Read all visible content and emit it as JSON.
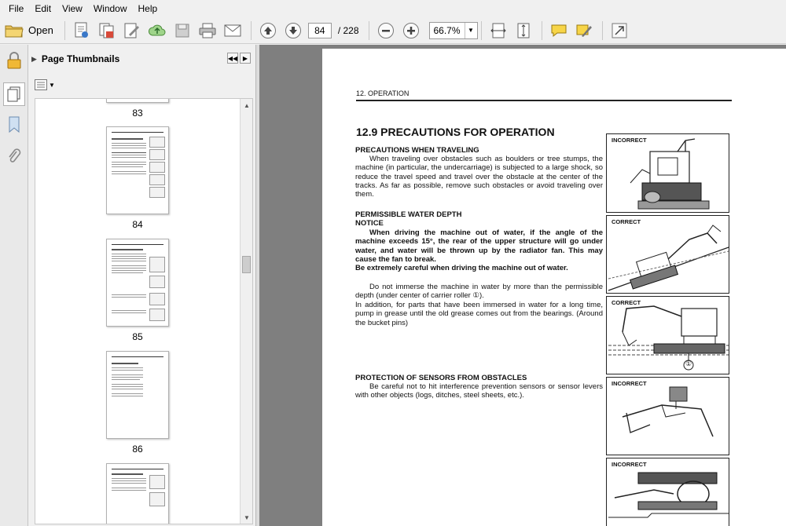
{
  "menu": [
    "File",
    "Edit",
    "View",
    "Window",
    "Help"
  ],
  "toolbar": {
    "open_label": "Open",
    "current_page": "84",
    "page_total": "/ 228",
    "zoom": "66.7%"
  },
  "thumbnail_panel": {
    "title": "Page Thumbnails",
    "thumbnails": [
      {
        "label": "83"
      },
      {
        "label": "84"
      },
      {
        "label": "85"
      },
      {
        "label": "86"
      }
    ]
  },
  "document": {
    "section_header": "12. OPERATION",
    "main_heading": "12.9  PRECAUTIONS FOR OPERATION",
    "traveling_heading": "PRECAUTIONS WHEN TRAVELING",
    "traveling_text": "When traveling over obstacles such as boulders or tree stumps, the machine (in particular, the undercarriage) is subjected to a large shock, so reduce the travel speed and travel over the obstacle at the center of the tracks. As far as possible, remove such obstacles or avoid traveling over them.",
    "water_heading": "PERMISSIBLE WATER DEPTH",
    "notice_heading": "NOTICE",
    "notice_text_1": "When driving the machine out of water, if the angle of the machine exceeds 15°, the rear of the upper structure will go under water, and water will be thrown up by the radiator fan. This may cause the fan to break.",
    "notice_text_2": "Be extremely careful when driving the machine out of water.",
    "water_text": "Do not immerse the machine in water by more than the permissible depth (under center of carrier roller ①).",
    "water_text_2": "In addition, for parts that have been immersed in water for a long time, pump in grease until the old grease comes out from the bearings. (Around the bucket pins)",
    "sensors_heading": "PROTECTION OF SENSORS FROM OBSTACLES",
    "sensors_text": "Be careful not to hit interference prevention sensors or sensor levers with other objects (logs, ditches, steel sheets, etc.).",
    "figures": [
      {
        "label": "INCORRECT"
      },
      {
        "label": "CORRECT"
      },
      {
        "label": "CORRECT",
        "callout": "①"
      },
      {
        "label": "INCORRECT"
      },
      {
        "label": "INCORRECT"
      }
    ]
  }
}
